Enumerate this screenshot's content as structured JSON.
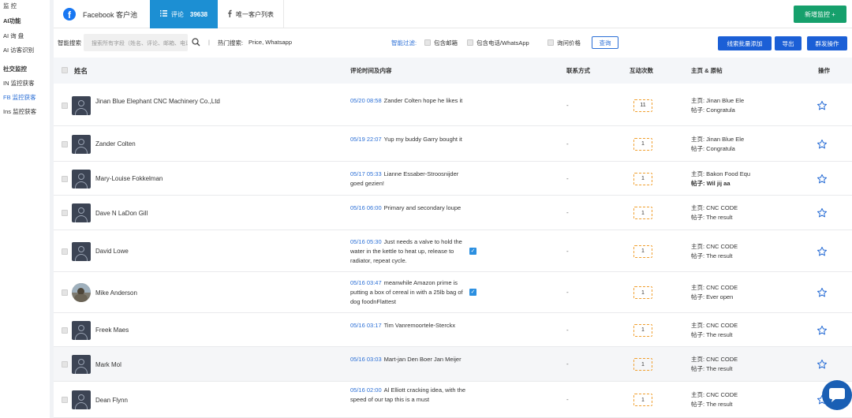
{
  "sidebar": {
    "items": [
      {
        "label": "监 控",
        "bold": false
      },
      {
        "label": "AI功能",
        "bold": true
      },
      {
        "label": "AI 询 盘",
        "bold": false
      },
      {
        "label": "AI 访客识别",
        "bold": false
      },
      {
        "label": "社交监控",
        "bold": true
      },
      {
        "label": "IN 监控获客",
        "bold": false
      },
      {
        "label": "FB 监控获客",
        "bold": false,
        "active": true
      },
      {
        "label": "Ins 监控获客",
        "bold": false
      }
    ]
  },
  "tabs": {
    "facebook_label": "Facebook 客户池",
    "facebook_icon_char": "f",
    "comments_label": "评论",
    "comments_count": "39638",
    "unique_label": "唯一客户列表"
  },
  "header": {
    "add_monitor": "新增监控 +"
  },
  "filter": {
    "smart_search_label": "智能搜索",
    "search_placeholder": "搜索所有字段（姓名、评论、邮箱、电话）",
    "separator": "|",
    "hot_label": "热门搜索:",
    "hot_terms": "Price, Whatsapp",
    "smart_filter_label": "智能过滤:",
    "opt_email": "包含邮箱",
    "opt_phone": "包含电话/WhatsApp",
    "opt_price": "询问价格",
    "query_button": "查询",
    "batch_add_button": "线索批量添加",
    "export_button": "导出",
    "group_send_button": "群发操作"
  },
  "table": {
    "headers": {
      "name": "姓名",
      "comment": "评论时间及内容",
      "contact": "联系方式",
      "interactions": "互动次数",
      "page_post": "主页 & 原帖",
      "actions": "操作"
    },
    "rows": [
      {
        "name": "Jinan Blue Elephant CNC Machinery Co.,Ltd",
        "time": "05/20 08:58",
        "comment": "Zander Colten hope he likes it",
        "contact": "-",
        "count": "11",
        "home": "主页: Jinan Blue Ele",
        "post": "帖子: Congratula",
        "avatar": "default",
        "translate": false
      },
      {
        "name": "Zander Colten",
        "time": "05/19 22:07",
        "comment": "Yup my buddy Garry bought it",
        "contact": "-",
        "count": "1",
        "home": "主页: Jinan Blue Ele",
        "post": "帖子: Congratula",
        "avatar": "default",
        "translate": false
      },
      {
        "name": "Mary-Louise Fokkelman",
        "time": "05/17 05:33",
        "comment": "Lianne Essaber-Stroosnijder goed gezien!",
        "contact": "-",
        "count": "1",
        "home": "主页: Bakon Food Equ",
        "post": "帖子: Wil jij aa",
        "avatar": "default",
        "translate": false,
        "post_bold": true
      },
      {
        "name": "Dave N LaDon Gill",
        "time": "05/16 06:00",
        "comment": "Primary and secondary loupe",
        "contact": "-",
        "count": "1",
        "home": "主页: CNC CODE",
        "post": "帖子: The result",
        "avatar": "default",
        "translate": false
      },
      {
        "name": "David Lowe",
        "time": "05/16 05:30",
        "comment": "Just needs a valve to hold the water in the kettle to heat up, release to radiator, repeat cycle.",
        "contact": "-",
        "count": "1",
        "home": "主页: CNC CODE",
        "post": "帖子: The result",
        "avatar": "default",
        "translate": true
      },
      {
        "name": "Mike Anderson",
        "time": "05/16 03:47",
        "comment": "meanwhile Amazon prime is putting a box of cereal in with a 25lb bag of dog foodnFlattest",
        "contact": "-",
        "count": "1",
        "home": "主页: CNC CODE",
        "post": "帖子: Ever open",
        "avatar": "photo",
        "translate": true
      },
      {
        "name": "Freek Maes",
        "time": "05/16 03:17",
        "comment": "Tim Vanremoortele-Sterckx",
        "contact": "-",
        "count": "1",
        "home": "主页: CNC CODE",
        "post": "帖子: The result",
        "avatar": "default",
        "translate": false
      },
      {
        "name": "Mark Mol",
        "time": "05/16 03:03",
        "comment": "Mart-jan Den Boer Jan Meijer",
        "contact": "-",
        "count": "1",
        "home": "主页: CNC CODE",
        "post": "帖子: The result",
        "avatar": "default",
        "translate": false
      },
      {
        "name": "Dean Flynn",
        "time": "05/16 02:00",
        "comment": "Al Elliott cracking idea, with the speed of our tap this is a must",
        "contact": "-",
        "count": "1",
        "home": "主页: CNC CODE",
        "post": "帖子: The result",
        "avatar": "default",
        "translate": false
      }
    ]
  },
  "colors": {
    "primary": "#1b5fd6",
    "tab_active": "#1c8fd3",
    "add_button": "#16a06c",
    "count_border": "#f0a030",
    "link_time": "#2b6fd6"
  },
  "icons": {
    "search": "search-icon",
    "star": "star-icon",
    "chat": "chat-bubble-icon",
    "translate": "translate-icon"
  }
}
